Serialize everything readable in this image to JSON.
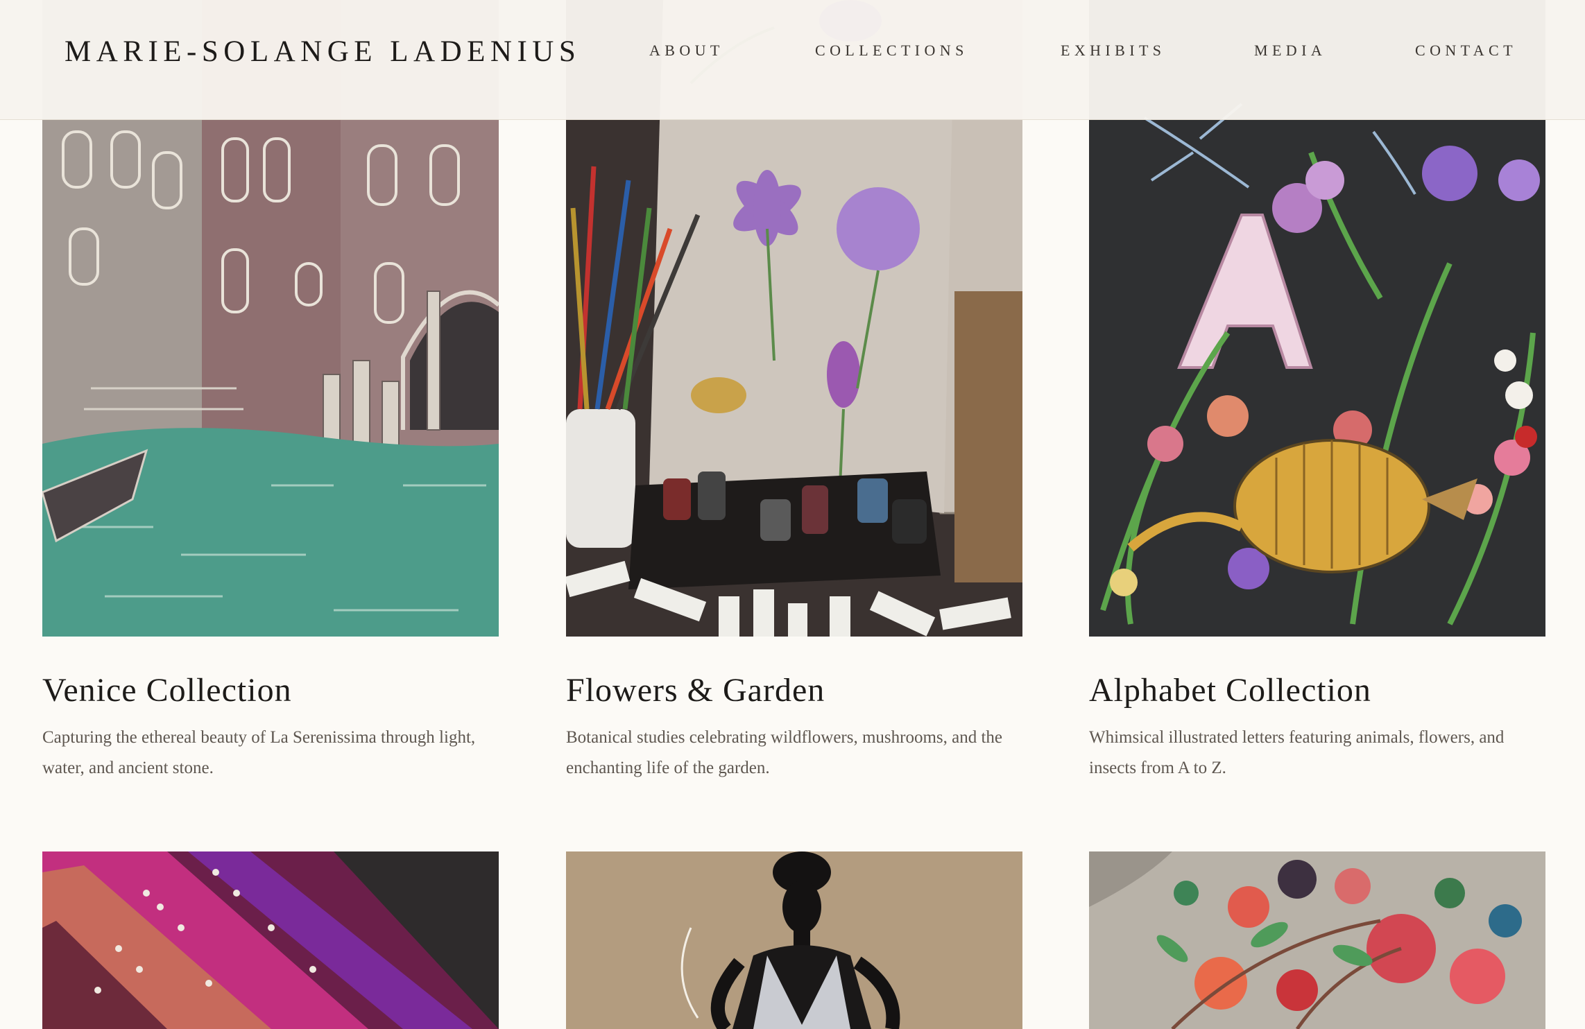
{
  "header": {
    "brand": "MARIE-SOLANGE LADENIUS",
    "nav": [
      "ABOUT",
      "COLLECTIONS",
      "EXHIBITS",
      "MEDIA",
      "CONTACT"
    ]
  },
  "collections": [
    {
      "title": "Venice Collection",
      "description": "Capturing the ethereal beauty of La Serenissima through light, water, and ancient stone.",
      "image": "venice-canal-painting"
    },
    {
      "title": "Flowers & Garden",
      "description": "Botanical studies celebrating wildflowers, mushrooms, and the enchanting life of the garden.",
      "image": "studio-easel-flower-sketches"
    },
    {
      "title": "Alphabet Collection",
      "description": "Whimsical illustrated letters featuring animals, flowers, and insects from A to Z.",
      "image": "letter-a-armadillo-botanical"
    }
  ],
  "second_row": [
    {
      "image": "embroidered-velvet-headbands"
    },
    {
      "image": "fashion-figure-sequin-gown"
    },
    {
      "image": "floral-embroidery-on-linen"
    }
  ],
  "colors": {
    "page_bg": "#fcfaf6",
    "header_bg": "#f7f4ee",
    "text_dark": "#1d1b19",
    "text_muted": "#5e5750"
  }
}
